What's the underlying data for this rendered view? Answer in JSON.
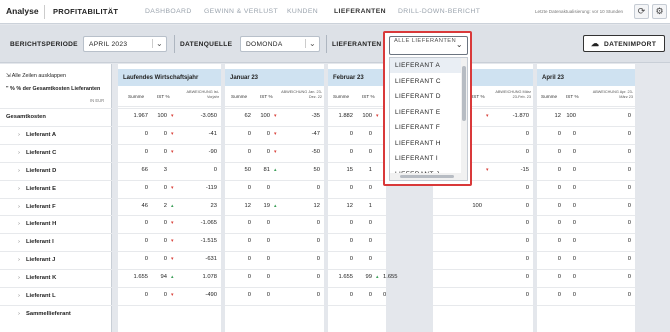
{
  "topbar": {
    "brand": "Analyse",
    "product": "PROFITABILITÄT",
    "nav": [
      "DASHBOARD",
      "GEWINN & VERLUST",
      "KUNDEN",
      "LIEFERANTEN",
      "DRILL-DOWN-BERICHT"
    ],
    "active_nav": "LIEFERANTEN",
    "last_update": "Letzte Datenaktualisierung: vor 10 Stunden"
  },
  "filters": {
    "period_label": "BERICHTSPERIODE",
    "period_value": "APRIL 2023",
    "source_label": "DATENQUELLE",
    "source_value": "DOMONDA",
    "supplier_label": "LIEFERANTEN",
    "import_label": "DATENIMPORT"
  },
  "dropdown": {
    "selected": "ALLE LIEFERANTEN",
    "options": [
      "LIEFERANT A",
      "LIEFERANT C",
      "LIEFERANT D",
      "LIEFERANT E",
      "LIEFERANT F",
      "LIEFERANT H",
      "LIEFERANT I",
      "LIEFERANT J"
    ]
  },
  "table": {
    "collapse_label": "Alle Zeilen ausklappen",
    "pct_row_label": "% der Gesamtkosten Lieferanten",
    "unit_label": "IN EUR",
    "rows": [
      {
        "name": "Gesamtkosten",
        "total": true
      },
      {
        "name": "Lieferant A"
      },
      {
        "name": "Lieferant C"
      },
      {
        "name": "Lieferant D"
      },
      {
        "name": "Lieferant E"
      },
      {
        "name": "Lieferant F"
      },
      {
        "name": "Lieferant H"
      },
      {
        "name": "Lieferant I"
      },
      {
        "name": "Lieferant J"
      },
      {
        "name": "Lieferant K"
      },
      {
        "name": "Lieferant L"
      },
      {
        "name": "Sammellieferant"
      }
    ],
    "columns": [
      {
        "title": "Laufendes Wirtschaftsjahr",
        "sub": [
          "Summe",
          "IST %",
          "ABWEICHUNG Ist-Vorjahr"
        ],
        "values": [
          [
            "1.967",
            "100",
            "-3.050",
            "red"
          ],
          [
            "0",
            "0",
            "-41",
            "red"
          ],
          [
            "0",
            "0",
            "-90",
            "red"
          ],
          [
            "66",
            "3",
            "0",
            ""
          ],
          [
            "0",
            "0",
            "-119",
            "red"
          ],
          [
            "46",
            "2",
            "23",
            "green"
          ],
          [
            "0",
            "0",
            "-1.065",
            "red"
          ],
          [
            "0",
            "0",
            "-1.515",
            "red"
          ],
          [
            "0",
            "0",
            "-631",
            "red"
          ],
          [
            "1.655",
            "94",
            "1.078",
            "green"
          ],
          [
            "0",
            "0",
            "-490",
            "red"
          ],
          [
            "",
            "",
            "",
            ""
          ]
        ]
      },
      {
        "title": "Januar 23",
        "sub": [
          "Summe",
          "IST %",
          "ABWEICHUNG Jan. 23-Dez. 22"
        ],
        "values": [
          [
            "62",
            "100",
            "-35",
            "red"
          ],
          [
            "0",
            "0",
            "-47",
            "red"
          ],
          [
            "0",
            "0",
            "-50",
            "red"
          ],
          [
            "50",
            "81",
            "50",
            "green"
          ],
          [
            "0",
            "0",
            "0",
            ""
          ],
          [
            "12",
            "19",
            "12",
            "green"
          ],
          [
            "0",
            "0",
            "0",
            ""
          ],
          [
            "0",
            "0",
            "0",
            ""
          ],
          [
            "0",
            "0",
            "0",
            ""
          ],
          [
            "0",
            "0",
            "0",
            ""
          ],
          [
            "0",
            "0",
            "0",
            ""
          ],
          [
            "",
            "",
            "",
            ""
          ]
        ]
      },
      {
        "title": "Februar 23",
        "sub": [
          "Summe",
          "IST %",
          "ABW"
        ],
        "values": [
          [
            "1.882",
            "100",
            "",
            "red"
          ],
          [
            "0",
            "0",
            "",
            ""
          ],
          [
            "0",
            "0",
            "",
            ""
          ],
          [
            "15",
            "1",
            "",
            ""
          ],
          [
            "0",
            "0",
            "",
            ""
          ],
          [
            "12",
            "1",
            "",
            ""
          ],
          [
            "0",
            "0",
            "",
            ""
          ],
          [
            "0",
            "0",
            "",
            ""
          ],
          [
            "0",
            "0",
            "",
            ""
          ],
          [
            "1.655",
            "99",
            "1.655",
            "green"
          ],
          [
            "0",
            "0",
            "0",
            ""
          ],
          [
            "",
            "",
            "",
            ""
          ]
        ]
      },
      {
        "title": "",
        "sub": [
          "",
          "IST %",
          "ABWEICHUNG März 23-Feb. 23"
        ],
        "values": [
          [
            "",
            "",
            "-1.870",
            "red"
          ],
          [
            "",
            "",
            "0",
            ""
          ],
          [
            "",
            "",
            "0",
            ""
          ],
          [
            "",
            "",
            "-15",
            "red"
          ],
          [
            "",
            "",
            "0",
            ""
          ],
          [
            "",
            "100",
            "0",
            ""
          ],
          [
            "",
            "",
            "0",
            ""
          ],
          [
            "",
            "",
            "0",
            ""
          ],
          [
            "",
            "",
            "0",
            ""
          ],
          [
            "",
            "",
            "0",
            ""
          ],
          [
            "",
            "",
            "0",
            ""
          ],
          [
            "",
            "",
            "",
            ""
          ]
        ]
      },
      {
        "title": "April 23",
        "sub": [
          "Summe",
          "IST %",
          "ABWEICHUNG Apr. 23-März 23"
        ],
        "values": [
          [
            "12",
            "100",
            "0",
            ""
          ],
          [
            "0",
            "0",
            "0",
            ""
          ],
          [
            "0",
            "0",
            "0",
            ""
          ],
          [
            "0",
            "0",
            "0",
            ""
          ],
          [
            "0",
            "0",
            "0",
            ""
          ],
          [
            "0",
            "0",
            "0",
            ""
          ],
          [
            "0",
            "0",
            "0",
            ""
          ],
          [
            "0",
            "0",
            "0",
            ""
          ],
          [
            "0",
            "0",
            "0",
            ""
          ],
          [
            "0",
            "0",
            "0",
            ""
          ],
          [
            "0",
            "0",
            "0",
            ""
          ],
          [
            "",
            "",
            "",
            ""
          ]
        ]
      }
    ]
  }
}
